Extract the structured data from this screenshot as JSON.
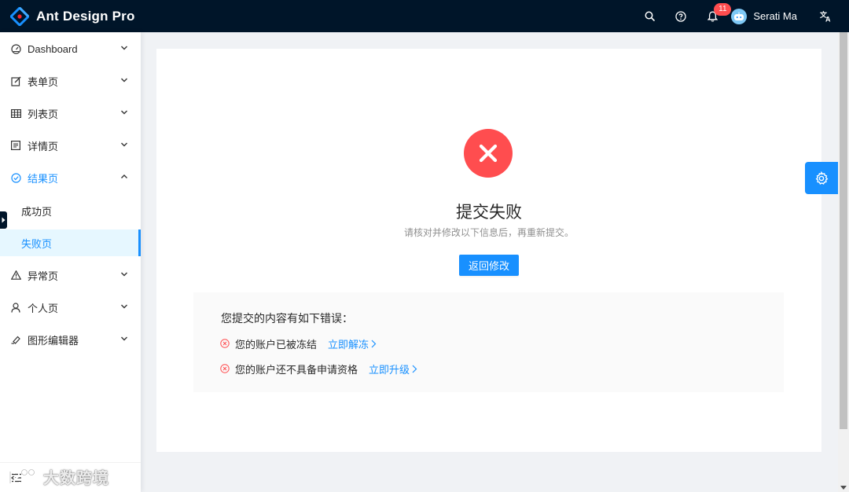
{
  "header": {
    "app_title": "Ant Design Pro",
    "notification_count": "11",
    "user_name": "Serati Ma",
    "icons": [
      "search-icon",
      "question-icon",
      "bell-icon",
      "translate-icon"
    ]
  },
  "sidebar": {
    "items": [
      {
        "label": "Dashboard",
        "icon": "dashboard-icon"
      },
      {
        "label": "表单页",
        "icon": "form-icon"
      },
      {
        "label": "列表页",
        "icon": "table-icon"
      },
      {
        "label": "详情页",
        "icon": "profile-icon"
      },
      {
        "label": "结果页",
        "icon": "check-circle-icon"
      },
      {
        "label": "异常页",
        "icon": "warning-icon"
      },
      {
        "label": "个人页",
        "icon": "user-icon"
      },
      {
        "label": "图形编辑器",
        "icon": "highlight-icon"
      }
    ],
    "sub_items": [
      {
        "label": "成功页"
      },
      {
        "label": "失败页"
      }
    ]
  },
  "result": {
    "title": "提交失败",
    "subtitle": "请核对并修改以下信息后，再重新提交。",
    "button_label": "返回修改",
    "error_heading": "您提交的内容有如下错误：",
    "errors": [
      {
        "text": "您的账户已被冻结",
        "link": "立即解冻"
      },
      {
        "text": "您的账户还不具备申请资格",
        "link": "立即升级"
      }
    ]
  },
  "watermark": {
    "text": "大数跨境"
  },
  "colors": {
    "primary": "#1890ff",
    "error": "#ff4d4f",
    "header_bg": "#001529"
  }
}
